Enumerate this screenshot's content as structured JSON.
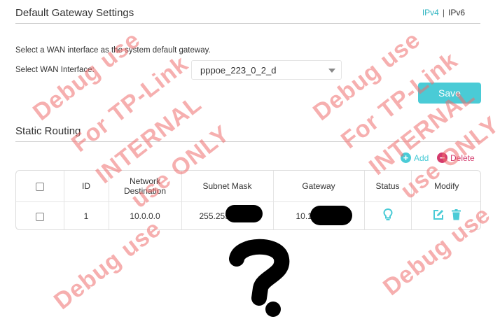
{
  "default_gateway": {
    "title": "Default Gateway Settings",
    "ip_tabs": {
      "ipv4": "IPv4",
      "separator": "|",
      "ipv6": "IPv6"
    },
    "description": "Select a WAN interface as the system default gateway.",
    "wan_label": "Select WAN Interface:",
    "wan_value": "pppoe_223_0_2_d",
    "save_label": "Save"
  },
  "static_routing": {
    "title": "Static Routing",
    "add_label": "Add",
    "delete_label": "Delete",
    "columns": {
      "id": "ID",
      "network_destination": "Network Destination",
      "subnet_mask": "Subnet Mask",
      "gateway": "Gateway",
      "status": "Status",
      "modify": "Modify"
    },
    "rows": [
      {
        "id": "1",
        "network_destination": "10.0.0.0",
        "subnet_mask": "255.255",
        "gateway": "10.1"
      }
    ]
  },
  "watermark": {
    "line1": "Debug use",
    "line2": "For TP-Link",
    "line3": "INTERNAL",
    "line4": "use ONLY"
  },
  "colors": {
    "accent": "#4acbd6",
    "delete": "#d43a6c",
    "watermark": "#ee6e6e"
  },
  "icons": {
    "add": "add-circle-icon",
    "delete": "minus-circle-icon",
    "status": "lightbulb-icon",
    "edit": "edit-icon",
    "trash": "trash-icon",
    "dropdown": "chevron-down-icon"
  }
}
